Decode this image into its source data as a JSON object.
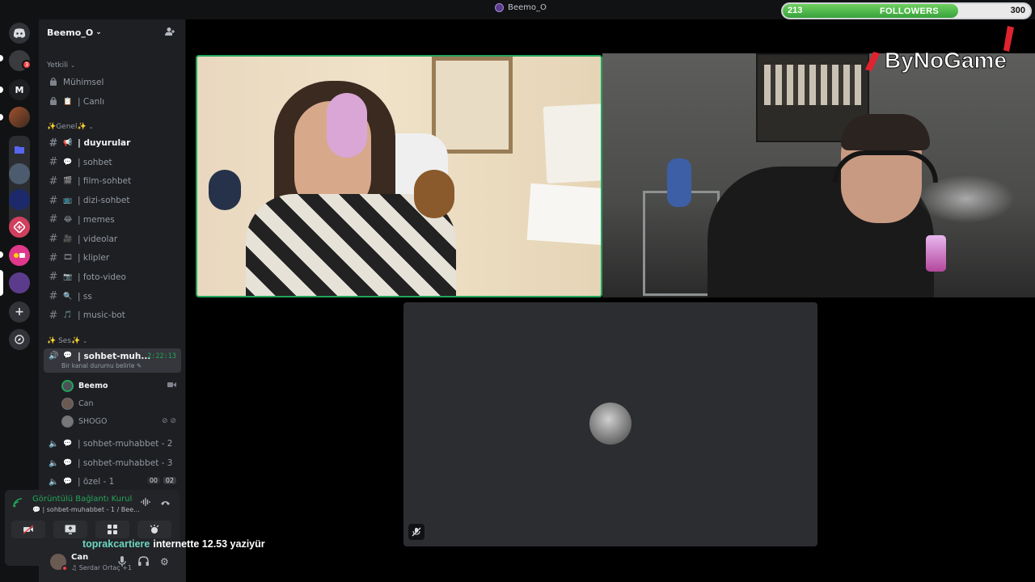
{
  "titlebar": {
    "title": "Beemo_O"
  },
  "followers": {
    "current": "213",
    "label": "FOLLOWERS",
    "goal": "300",
    "progress_fraction": 0.71
  },
  "logo": {
    "text": "ByNoGame"
  },
  "rail": {
    "servers": [
      {
        "icon": "discord-home-icon"
      },
      {
        "icon": "avatar",
        "badge": "3"
      },
      {
        "icon": "letter-icon",
        "letter": "M"
      },
      {
        "icon": "server-avatar"
      },
      {
        "icon": "folder-icon"
      },
      {
        "icon": "server-avatar"
      },
      {
        "icon": "server-avatar"
      },
      {
        "icon": "server-avatar"
      },
      {
        "icon": "server-avatar"
      },
      {
        "icon": "server-avatar"
      },
      {
        "icon": "add-server-icon"
      },
      {
        "icon": "explore-icon"
      }
    ]
  },
  "server": {
    "name": "Beemo_O"
  },
  "categories": {
    "yetkili": "Yetkili",
    "genel": "✨Genel✨",
    "ses": "✨ Ses✨"
  },
  "channels_yetkili": [
    {
      "name": "Mühimsel",
      "emoji": ""
    },
    {
      "name": "| Canlı",
      "emoji": "📋"
    }
  ],
  "channels_genel": [
    {
      "name": "| duyurular",
      "emoji": "📢",
      "active": true
    },
    {
      "name": "| sohbet",
      "emoji": "💬"
    },
    {
      "name": "| film-sohbet",
      "emoji": "🎬"
    },
    {
      "name": "| dizi-sohbet",
      "emoji": "📺"
    },
    {
      "name": "| memes",
      "emoji": "😂"
    },
    {
      "name": "| videolar",
      "emoji": "🎥"
    },
    {
      "name": "| klipler",
      "emoji": "🎞"
    },
    {
      "name": "| foto-video",
      "emoji": "📷"
    },
    {
      "name": "| ss",
      "emoji": "🔍"
    },
    {
      "name": "| music-bot",
      "emoji": "🎵"
    }
  ],
  "voice_active": {
    "name": "| sohbet-muh...",
    "timer": "2:22:13",
    "status": "Bir kanal durumu belirle"
  },
  "voice_users": [
    {
      "name": "Beemo",
      "speaking": true,
      "right_icon": "video-icon"
    },
    {
      "name": "Can",
      "speaking": false,
      "right_icon": ""
    },
    {
      "name": "SHOGO",
      "speaking": false,
      "right_icon": "muted-deafened-icons"
    }
  ],
  "voice_channels": [
    {
      "name": "| sohbet-muhabbet - 2"
    },
    {
      "name": "| sohbet-muhabbet - 3"
    },
    {
      "name": "| özel - 1",
      "count_a": "00",
      "count_b": "02"
    }
  ],
  "connection": {
    "status": "Görüntülü Bağlantı Kuruldu",
    "location": "| sohbet-muhabbet - 1 / Bee..."
  },
  "user": {
    "name": "Can",
    "activity": "♫ Serdar Ortaç +1"
  },
  "chat": {
    "username": "toprakcartiere",
    "message": "internette 12.53 yaziyür"
  },
  "colors": {
    "accent_green": "#23a55a",
    "sidebar_bg": "#1e1f22",
    "rail_bg": "#111214",
    "tile_bg": "#2b2d31",
    "chat_user": "#6dd6c0"
  }
}
